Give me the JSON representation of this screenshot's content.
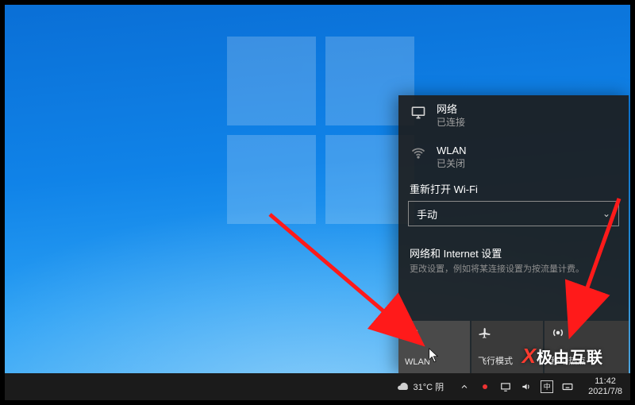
{
  "network_flyout": {
    "ethernet": {
      "title": "网络",
      "status": "已连接"
    },
    "wlan": {
      "title": "WLAN",
      "status": "已关闭"
    },
    "reopen_label": "重新打开 Wi-Fi",
    "dropdown_value": "手动",
    "settings_title": "网络和 Internet 设置",
    "settings_sub": "更改设置，例如将某连接设置为按流量计费。",
    "tiles": [
      {
        "label": "WLAN",
        "icon": "wifi"
      },
      {
        "label": "飞行模式",
        "icon": "airplane"
      },
      {
        "label": "移动热点",
        "icon": "hotspot"
      }
    ]
  },
  "taskbar": {
    "weather_text": "31°C 阴",
    "time": "11:42",
    "date": "2021/7/8"
  },
  "watermark": "极由互联",
  "colors": {
    "flyout_bg": "#1c1c1c",
    "tile_bg": "#3a3a3a",
    "accent_arrow": "#ff1a1a"
  }
}
